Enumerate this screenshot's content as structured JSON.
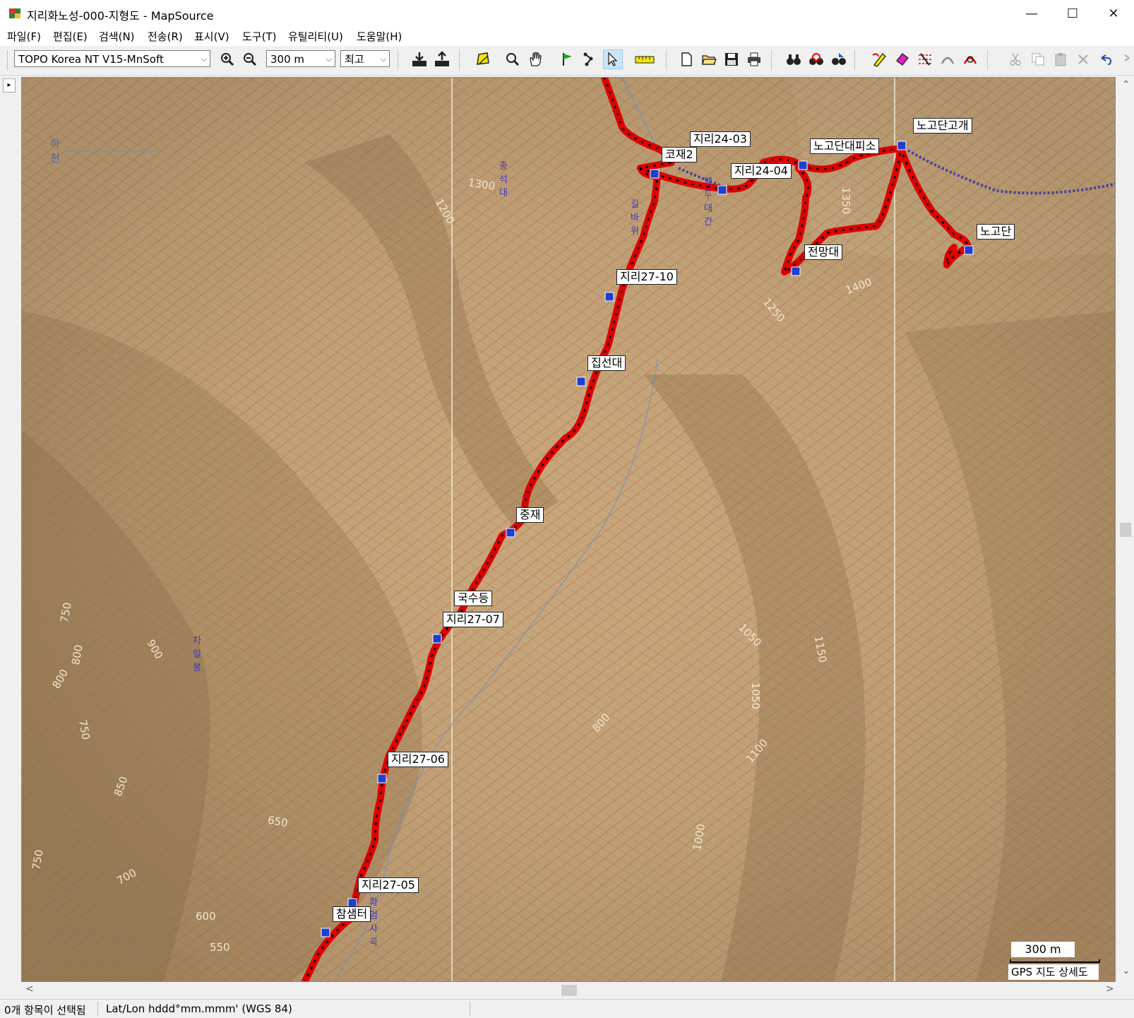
{
  "window": {
    "title": "지리화노성-000-지형도 - MapSource"
  },
  "menu": [
    "파일(F)",
    "편집(E)",
    "검색(N)",
    "전송(R)",
    "표시(V)",
    "도구(T)",
    "유틸리티(U)",
    "도움말(H)"
  ],
  "toolbar": {
    "map_product": "TOPO Korea NT V15-MnSoft",
    "zoom_scale": "300 m",
    "detail_level": "최고"
  },
  "map": {
    "labels": [
      {
        "id": "jiri24-03",
        "text": "지리24-03"
      },
      {
        "id": "kojae2",
        "text": "코재2"
      },
      {
        "id": "jiri24-04",
        "text": "지리24-04"
      },
      {
        "id": "nogodan-shelter",
        "text": "노고단대피소"
      },
      {
        "id": "nogodan-pass",
        "text": "노고단고개"
      },
      {
        "id": "nogodan",
        "text": "노고단"
      },
      {
        "id": "observatory",
        "text": "전망대"
      },
      {
        "id": "jiri27-10",
        "text": "지리27-10"
      },
      {
        "id": "jipseondae",
        "text": "집선대"
      },
      {
        "id": "jungjae",
        "text": "중재"
      },
      {
        "id": "guksudeung",
        "text": "국수등"
      },
      {
        "id": "jiri27-07",
        "text": "지리27-07"
      },
      {
        "id": "jiri27-06",
        "text": "지리27-06"
      },
      {
        "id": "jiri27-05",
        "text": "지리27-05"
      },
      {
        "id": "chamsaemteo",
        "text": "참샘터"
      }
    ],
    "contours": [
      "1300",
      "1200",
      "1350",
      "1400",
      "1250",
      "1050",
      "1150",
      "1050",
      "800",
      "1100",
      "1000",
      "750",
      "800",
      "900",
      "800",
      "750",
      "850",
      "650",
      "750",
      "700",
      "600",
      "550"
    ],
    "place_names": [
      "하천",
      "종석대",
      "차일봉",
      "화엄사곡",
      "백두대간",
      "길바위"
    ],
    "scale_label": "300 m",
    "detail_label": "GPS 지도 상세도"
  },
  "status": {
    "selection": "0개 항목이 선택됨",
    "coord_format": "Lat/Lon hddd°mm.mmm' (WGS 84)"
  },
  "colors": {
    "track": "#e00000",
    "terrain": "#c7a57a",
    "contour": "#c0623a"
  }
}
